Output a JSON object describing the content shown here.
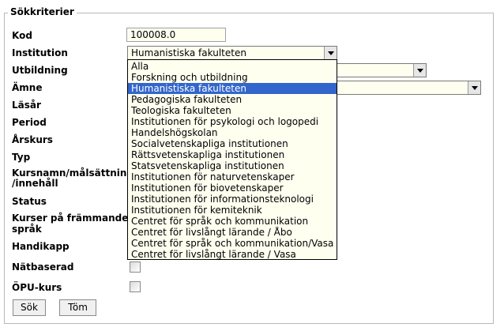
{
  "form": {
    "legend": "Sökkriterier",
    "labels": {
      "kod": "Kod",
      "institution": "Institution",
      "utbildning": "Utbildning",
      "amne": "Ämne",
      "lasar": "Läsår",
      "period": "Period",
      "arskurs": "Årskurs",
      "typ": "Typ",
      "kursnamn_line1": "Kursnamn/målsättning",
      "kursnamn_line2": "/innehåll",
      "status": "Status",
      "kurser_line1": "Kurser på främmande",
      "kurser_line2": "språk",
      "handikapp": "Handikapp",
      "natbaserad": "Nätbaserad",
      "opu": "ÖPU-kurs"
    },
    "kod_value": "100008.0",
    "institution_selected": "Humanistiska fakulteten",
    "institution_options": [
      "Alla",
      "Forskning och utbildning",
      "Humanistiska fakulteten",
      "Pedagogiska fakulteten",
      "Teologiska fakulteten",
      "Institutionen för psykologi och logopedi",
      "Handelshögskolan",
      "Socialvetenskapliga institutionen",
      "Rättsvetenskapliga institutionen",
      "Statsvetenskapliga institutionen",
      "Institutionen för naturvetenskaper",
      "Institutionen för biovetenskaper",
      "Institutionen för informationsteknologi",
      "Institutionen för kemiteknik",
      "Centret för språk och kommunikation",
      "Centret för livslångt lärande / Åbo",
      "Centret för språk och kommunikation/Vasa",
      "Centret för livslångt lärande / Vasa"
    ],
    "highlighted_index": 2,
    "buttons": {
      "search": "Sök",
      "clear": "Töm"
    }
  }
}
